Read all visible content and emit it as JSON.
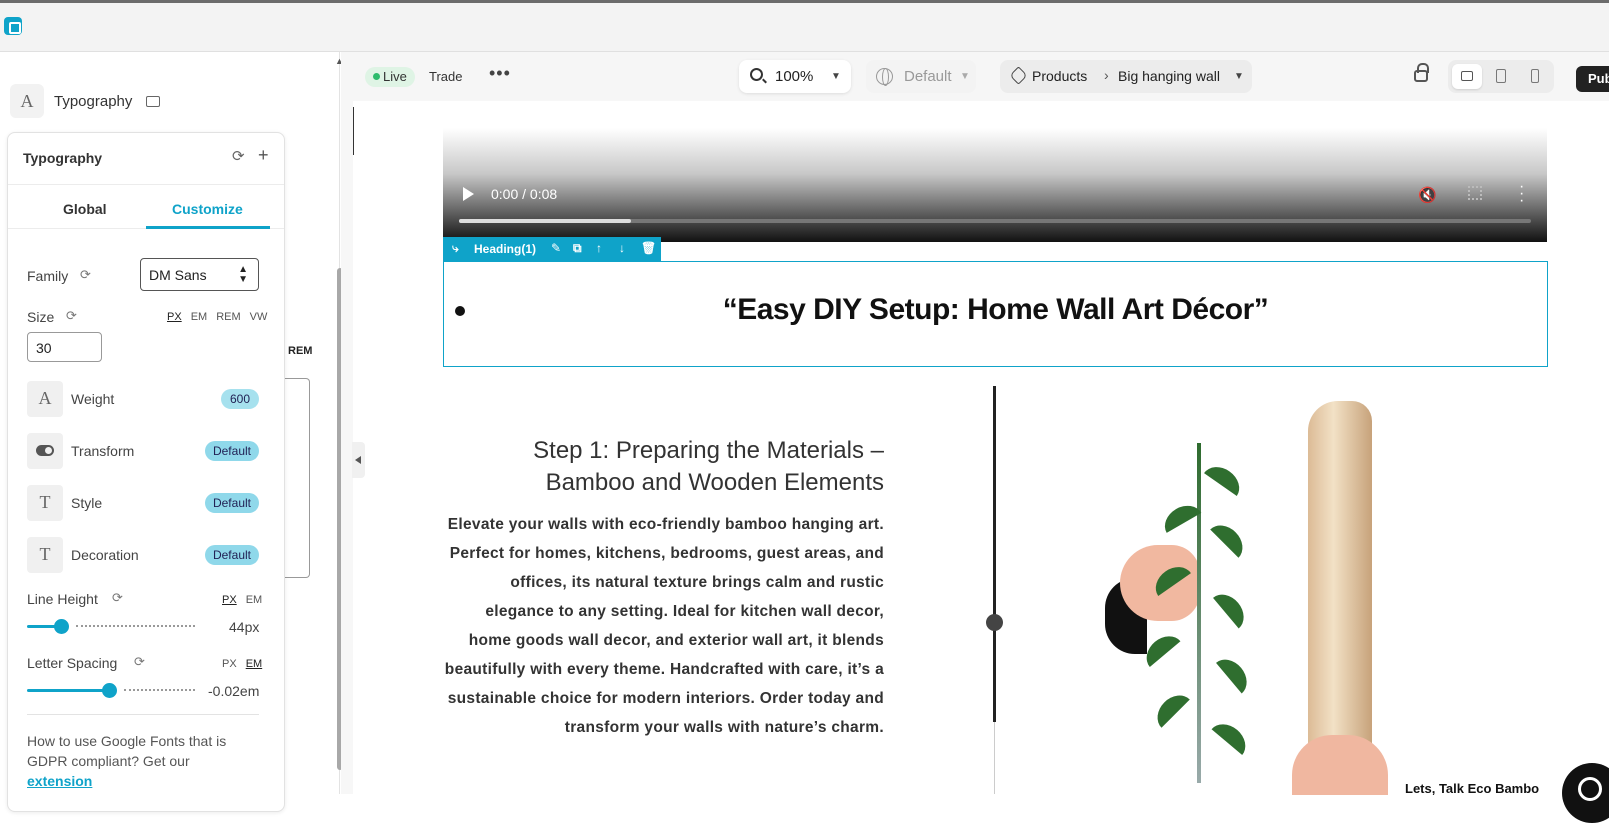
{
  "left_panel": {
    "section_label": "Typography",
    "under_panel_unit": "REM",
    "typography": {
      "title": "Typography",
      "tabs": [
        "Global",
        "Customize"
      ],
      "active_tab": "Customize",
      "family": {
        "label": "Family",
        "value": "DM Sans"
      },
      "size": {
        "label": "Size",
        "value": "30",
        "units": [
          "PX",
          "EM",
          "REM",
          "VW"
        ],
        "active_unit": "PX"
      },
      "properties": [
        {
          "label": "Weight",
          "value": "600"
        },
        {
          "label": "Transform",
          "value": "Default"
        },
        {
          "label": "Style",
          "value": "Default"
        },
        {
          "label": "Decoration",
          "value": "Default"
        }
      ],
      "line_height": {
        "label": "Line Height",
        "units": [
          "PX",
          "EM"
        ],
        "active_unit": "PX",
        "value": "44px",
        "level": 0.2
      },
      "letter_spacing": {
        "label": "Letter Spacing",
        "units": [
          "PX",
          "EM"
        ],
        "active_unit": "EM",
        "value": "-0.02em",
        "level": 0.49
      },
      "help_text": "How to use Google Fonts that is GDPR compliant? Get our",
      "help_link": "extension"
    }
  },
  "toolbar": {
    "live_label": "Live",
    "trade_label": "Trade",
    "zoom": "100%",
    "view": "Default",
    "breadcrumb": [
      "Products",
      "Big hanging wall"
    ],
    "publish_label": "Pub"
  },
  "page": {
    "video": {
      "time": "0:00 / 0:08",
      "progress": 0.16
    },
    "element_label": "Heading(1)",
    "heading": "“Easy DIY Setup: Home Wall Art Décor”",
    "step_title": "Step 1: Preparing the Materials – Bamboo and Wooden Elements",
    "step_body": "Elevate your walls with eco-friendly bamboo hanging art. Perfect for homes, kitchens, bedrooms, guest areas, and offices, its natural texture brings calm and rustic elegance to any setting. Ideal for kitchen wall decor, home goods wall decor, and exterior wall art, it blends beautifully with every theme. Handcrafted with care, it’s a sustainable choice for modern interiors. Order today and transform your walls with nature’s charm.",
    "caption": "Lets, Talk Eco Bambo"
  },
  "colors": {
    "accent": "#0fa3c9",
    "live_dot": "#2dbb6c"
  }
}
